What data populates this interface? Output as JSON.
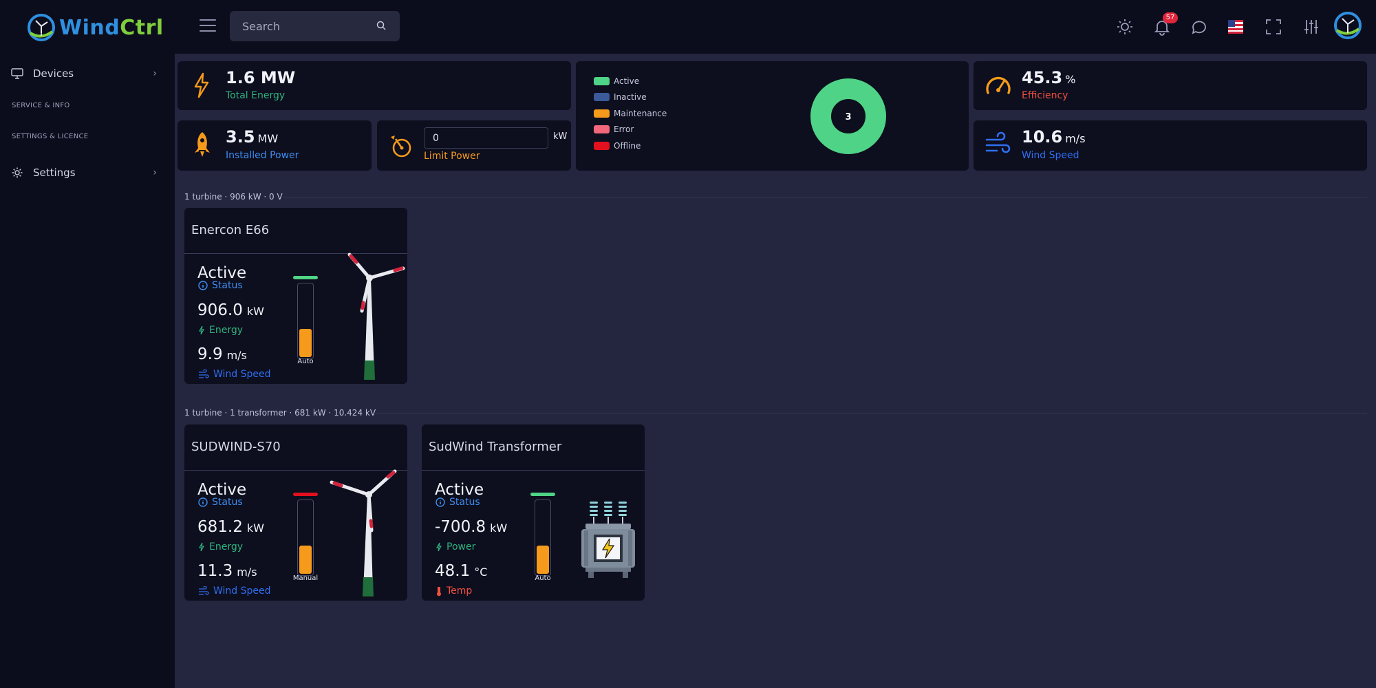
{
  "brand": {
    "name_part1": "Wind",
    "name_part2": "Ctrl"
  },
  "header": {
    "search_placeholder": "Search",
    "notification_count": "57",
    "icons": [
      "sun-icon",
      "bell-icon",
      "chat-icon",
      "us-flag-icon",
      "fullscreen-icon",
      "sliders-icon",
      "avatar-logo-icon"
    ]
  },
  "sidebar": {
    "devices_label": "Devices",
    "section_service": "SERVICE & INFO",
    "section_settings": "SETTINGS & LICENCE",
    "settings_label": "Settings"
  },
  "kpis": {
    "total_energy": {
      "value": "1.6 MW",
      "label": "Total Energy"
    },
    "installed_power": {
      "value": "3.5",
      "unit": "MW",
      "label": "Installed Power"
    },
    "limit_power": {
      "input_value": "0",
      "unit": "kW",
      "label": "Limit Power"
    },
    "efficiency": {
      "value": "45.3",
      "unit": "%",
      "label": "Efficiency"
    },
    "wind_speed": {
      "value": "10.6",
      "unit": "m/s",
      "label": "Wind Speed"
    }
  },
  "status_legend": [
    {
      "label": "Active",
      "color": "#4fd386"
    },
    {
      "label": "Inactive",
      "color": "#3b5a9a"
    },
    {
      "label": "Maintenance",
      "color": "#f59a1b"
    },
    {
      "label": "Error",
      "color": "#f06879"
    },
    {
      "label": "Offline",
      "color": "#e3101e"
    }
  ],
  "donut": {
    "center_label": "3",
    "active_count": 3,
    "total_count": 3,
    "color": "#4fd386"
  },
  "groups": [
    {
      "label": "1 turbine · 906 kW · 0 V"
    },
    {
      "label": "1 turbine · 1 transformer · 681 kW · 10.424 kV"
    }
  ],
  "devices": {
    "enercon": {
      "title": "Enercon E66",
      "status": "Active",
      "status_label": "Status",
      "energy_value": "906.0",
      "energy_unit": "kW",
      "energy_label": "Energy",
      "wind_value": "9.9",
      "wind_unit": "m/s",
      "wind_label": "Wind Speed",
      "mode": "Auto",
      "gauge_level": 0.38,
      "cap_color": "#4fd386"
    },
    "sudwind": {
      "title": "SUDWIND-S70",
      "status": "Active",
      "status_label": "Status",
      "energy_value": "681.2",
      "energy_unit": "kW",
      "energy_label": "Energy",
      "wind_value": "11.3",
      "wind_unit": "m/s",
      "wind_label": "Wind Speed",
      "mode": "Manual",
      "gauge_level": 0.38,
      "cap_color": "#e3101e"
    },
    "transformer": {
      "title": "SudWind Transformer",
      "status": "Active",
      "status_label": "Status",
      "power_value": "-700.8",
      "power_unit": "kW",
      "power_label": "Power",
      "temp_value": "48.1",
      "temp_unit": "°C",
      "temp_label": "Temp",
      "mode": "Auto",
      "gauge_level": 0.38,
      "cap_color": "#4fd386"
    }
  },
  "colors": {
    "accent_orange": "#f59a1b",
    "energy_green": "#2fb37e",
    "wind_blue": "#2f6ff2",
    "status_blue": "#3d8ef0",
    "temp_red": "#f2503f"
  }
}
